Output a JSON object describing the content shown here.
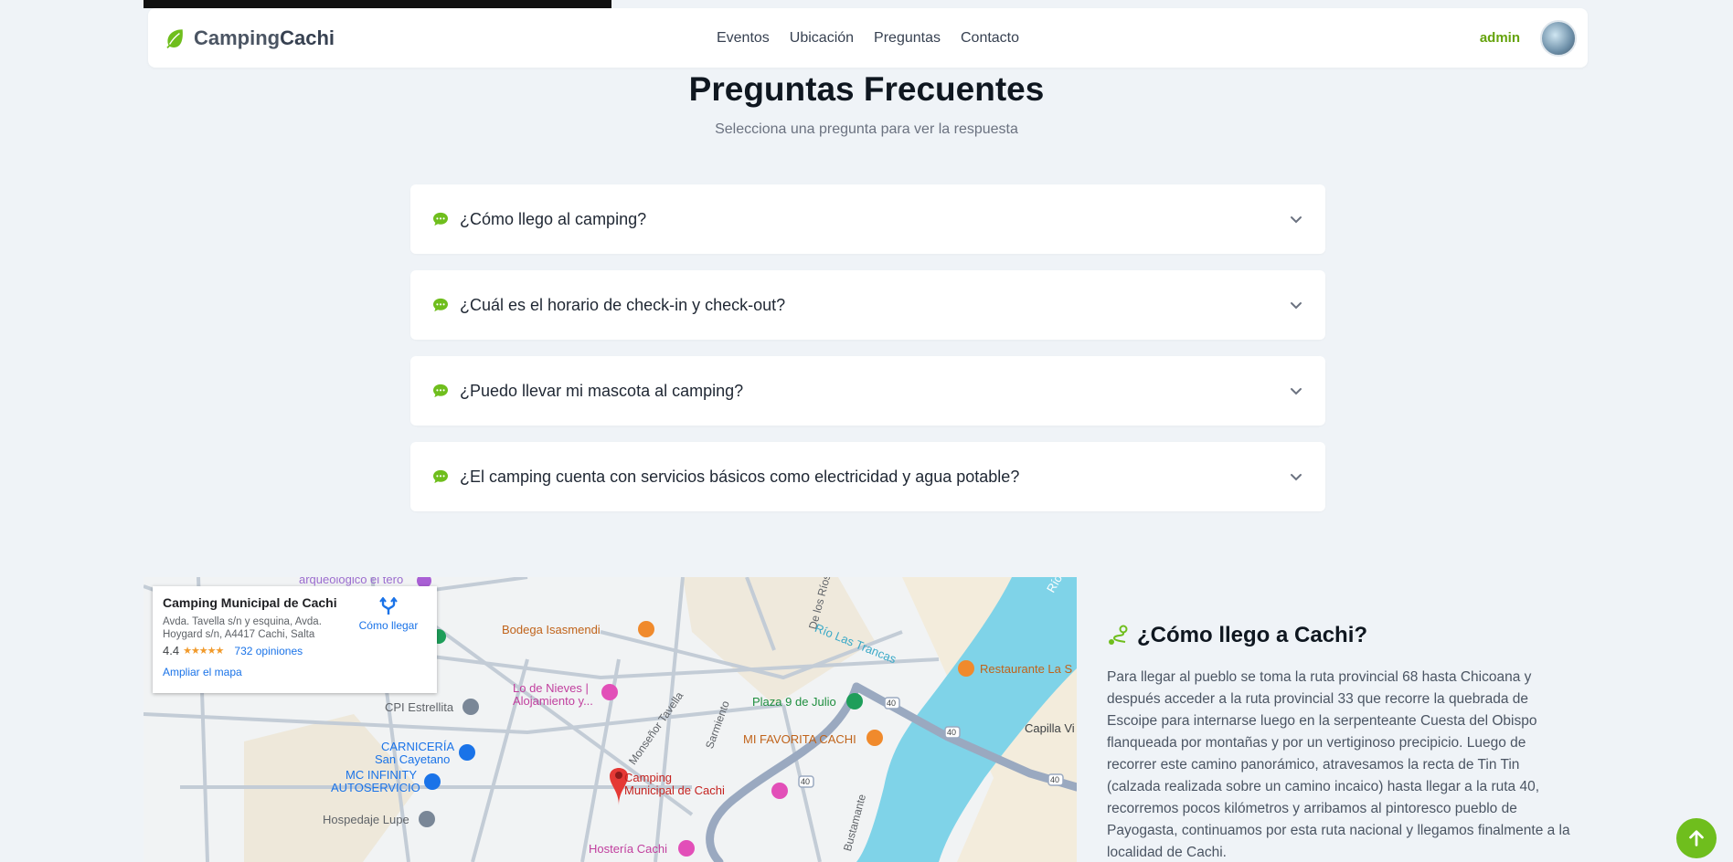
{
  "brand": {
    "name_part1": "Camping",
    "name_part2": "Cachi"
  },
  "nav": {
    "items": [
      "Eventos",
      "Ubicación",
      "Preguntas",
      "Contacto"
    ]
  },
  "user": {
    "name": "admin"
  },
  "faq": {
    "title": "Preguntas Frecuentes",
    "subtitle": "Selecciona una pregunta para ver la respuesta",
    "questions": [
      "¿Cómo llego al camping?",
      "¿Cuál es el horario de check-in y check-out?",
      "¿Puedo llevar mi mascota al camping?",
      "¿El camping cuenta con servicios básicos como electricidad y agua potable?"
    ]
  },
  "map": {
    "card": {
      "title": "Camping Municipal de Cachi",
      "address": "Avda. Tavella s/n y esquina, Avda. Hoygard s/n, A4417 Cachi, Salta",
      "rating": "4.4",
      "stars": "★★★★★",
      "reviews": "732 opiniones",
      "directions": "Cómo llegar",
      "expand": "Ampliar el mapa"
    },
    "places": {
      "bodega": "Bodega Isasmendi",
      "nieves_1": "Lo de Nieves |",
      "nieves_2": "Alojamiento y...",
      "cpi": "CPI Estrellita",
      "carniceria_1": "CARNICERÍA",
      "carniceria_2": "San Cayetano",
      "mc_1": "MC INFINITY",
      "mc_2": "AUTOSERVICIO",
      "hospedaje": "Hospedaje Lupe",
      "camping_1": "Camping",
      "camping_2": "Municipal de Cachi",
      "hosteria": "Hostería Cachi",
      "plaza": "Plaza 9 de Julio",
      "favorita": "MI FAVORITA CACHI",
      "restaurante": "Restaurante La S",
      "capilla": "Capilla Vi",
      "rio_co": "Río Co",
      "arqueologico": "arqueologico el tero"
    },
    "streets": {
      "de_los_rios": "De los Ríos",
      "rio_las_trancas": "Río Las Trancas",
      "monsenor": "Monseñor Tavella",
      "sarmiento": "Sarmiento",
      "bustamante": "Bustamante"
    },
    "route_badges": [
      "40",
      "40",
      "40",
      "40"
    ]
  },
  "info": {
    "title": "¿Cómo llego a Cachi?",
    "text": "Para llegar al pueblo se toma la ruta provincial 68 hasta Chicoana y después acceder a la ruta provincial 33 que recorre la quebrada de Escoipe para internarse luego en la serpenteante Cuesta del Obispo flanqueada por montañas y por un vertiginoso precipicio. Luego de recorrer este camino panorámico, atravesamos la recta de Tin Tin (calzada realizada sobre un camino incaico) hasta llegar a la ruta 40, recorremos pocos kilómetros y arribamos al pintoresco pueblo de Payogasta, continuamos por esta ruta nacional y llegamos finalmente a la localidad de Cachi."
  },
  "colors": {
    "accent": "#6fbe1d",
    "water": "#7fd3e8",
    "pin": "#e53935"
  }
}
